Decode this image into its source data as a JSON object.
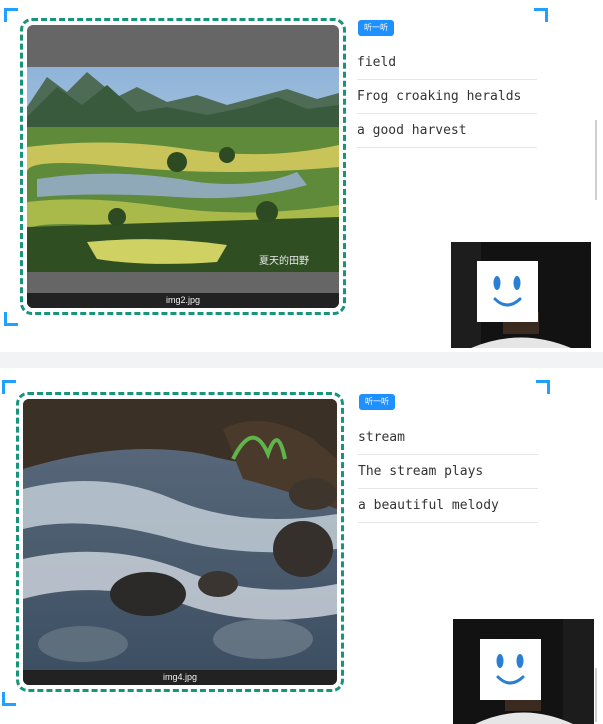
{
  "cards": [
    {
      "image_caption": "img2.jpg",
      "image_watermark": "夏天的田野",
      "listen_label": "听一听",
      "words": [
        "field",
        "Frog croaking heralds",
        "a good harvest"
      ]
    },
    {
      "image_caption": "img4.jpg",
      "listen_label": "听一听",
      "words": [
        "stream",
        "The stream plays",
        "a beautiful melody"
      ]
    }
  ],
  "colors": {
    "accent": "#20a0ff",
    "frame_border": "#17957a",
    "button": "#1e90ff"
  },
  "icons": {
    "face": "smiley-face-icon",
    "corner": "corner-bracket-icon"
  }
}
